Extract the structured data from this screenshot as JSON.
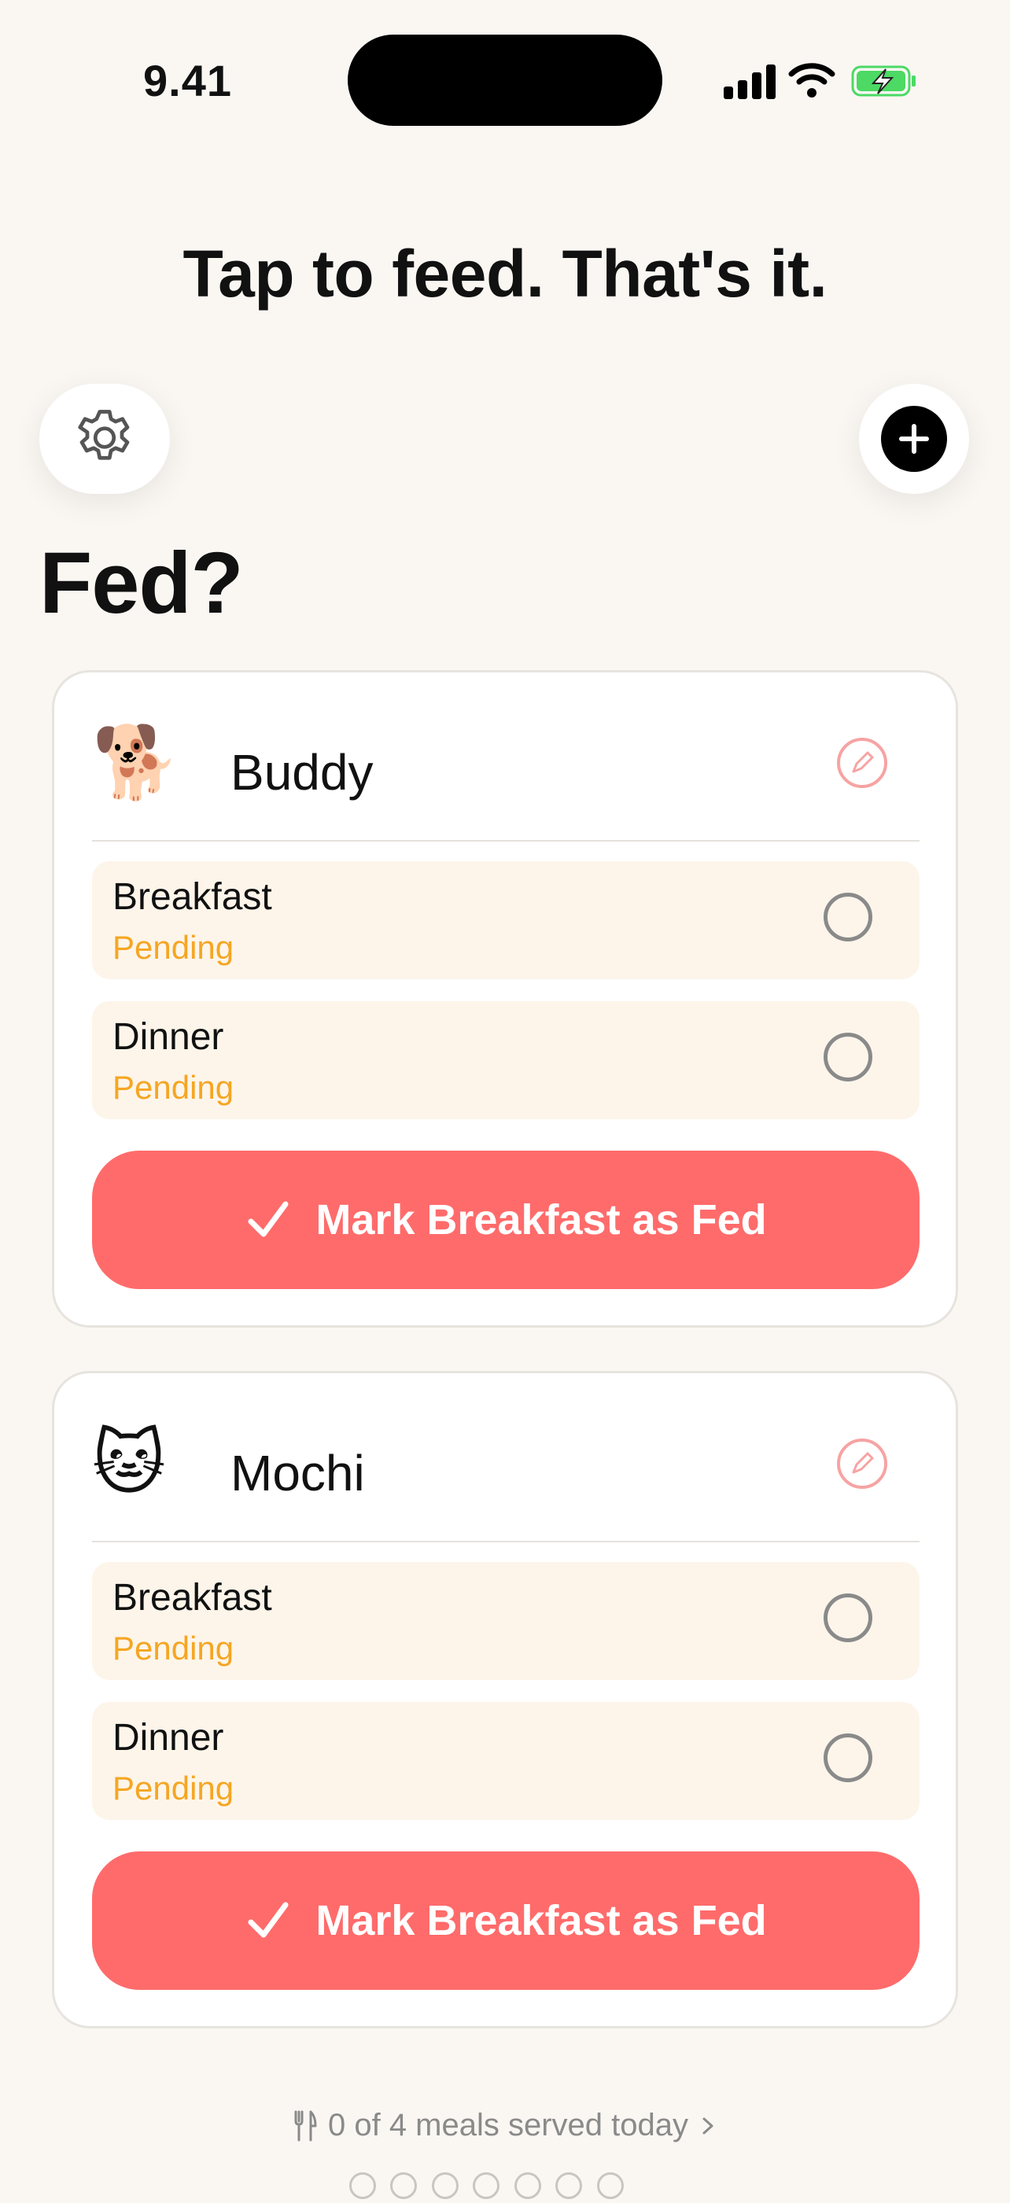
{
  "status_bar": {
    "time": "9.41"
  },
  "tagline": "Tap to feed. That's it.",
  "toolbar": {
    "settings_icon": "gear-icon",
    "add_icon": "plus-icon"
  },
  "heading": "Fed?",
  "pets": [
    {
      "emoji": "🐕",
      "name": "Buddy",
      "meals": [
        {
          "name": "Breakfast",
          "status": "Pending"
        },
        {
          "name": "Dinner",
          "status": "Pending"
        }
      ],
      "action_label": "Mark Breakfast as Fed"
    },
    {
      "emoji": "🐱",
      "name": "Mochi",
      "meals": [
        {
          "name": "Breakfast",
          "status": "Pending"
        },
        {
          "name": "Dinner",
          "status": "Pending"
        }
      ],
      "action_label": "Mark Breakfast as Fed"
    }
  ],
  "footer": {
    "summary": "0 of 4 meals served today",
    "icon": "utensils-icon"
  },
  "colors": {
    "accent": "#ff6b6b",
    "pending": "#f5a623",
    "meal_bg": "#fdf5ea",
    "background": "#faf7f3"
  }
}
